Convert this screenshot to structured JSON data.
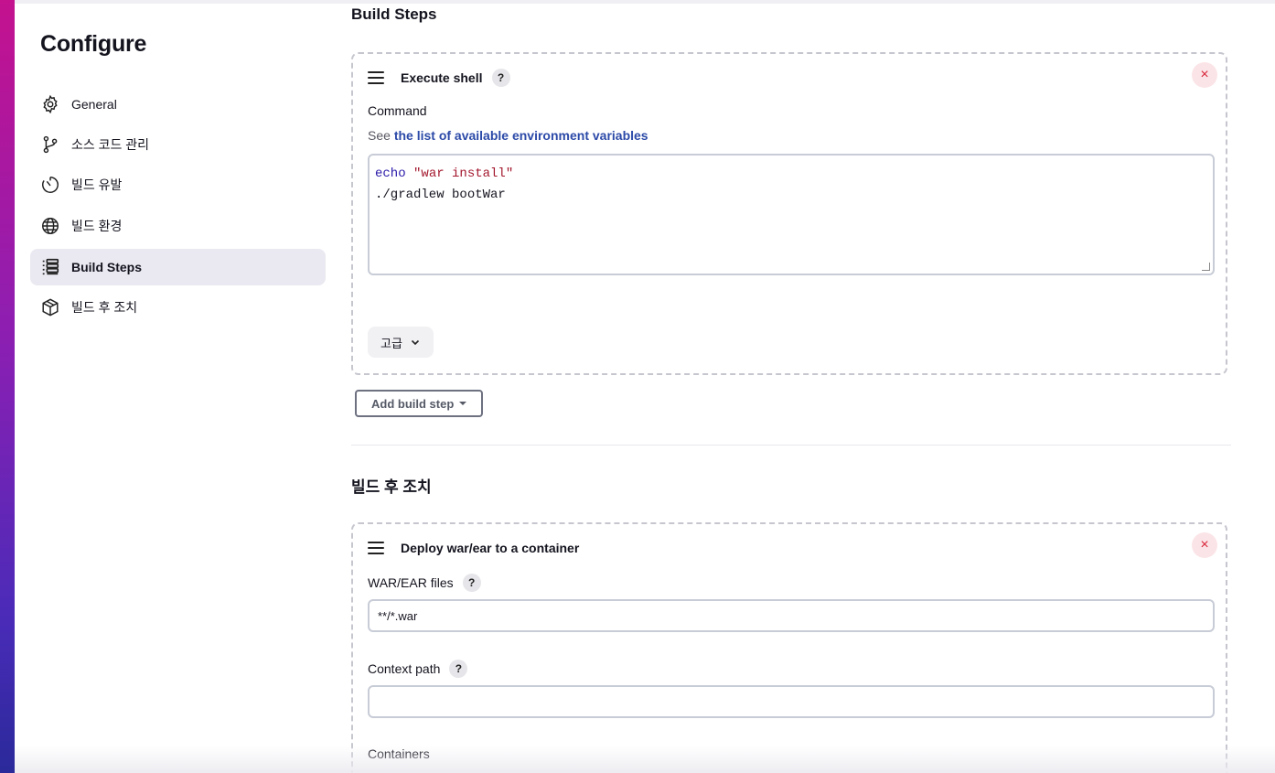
{
  "sidebar": {
    "title": "Configure",
    "items": [
      {
        "label": "General",
        "icon": "gear-icon"
      },
      {
        "label": "소스 코드 관리",
        "icon": "branch-icon"
      },
      {
        "label": "빌드 유발",
        "icon": "timer-icon"
      },
      {
        "label": "빌드 환경",
        "icon": "globe-icon"
      },
      {
        "label": "Build Steps",
        "icon": "list-steps-icon",
        "active": true
      },
      {
        "label": "빌드 후 조치",
        "icon": "package-icon"
      }
    ]
  },
  "build_steps": {
    "section_title": "Build Steps",
    "execute_shell": {
      "title": "Execute shell",
      "help": "?",
      "close": "×",
      "command_label": "Command",
      "see_prefix": "See",
      "env_link": "the list of available environment variables",
      "code": {
        "line1_keyword": "echo",
        "line1_string": "\"war install\"",
        "line2": "./gradlew bootWar"
      },
      "advanced_label": "고급"
    },
    "add_build_step_label": "Add build step"
  },
  "post_build": {
    "section_title": "빌드 후 조치",
    "deploy": {
      "title": "Deploy war/ear to a container",
      "close": "×",
      "war_label": "WAR/EAR files",
      "war_value": "**/*.war",
      "context_label": "Context path",
      "context_value": "",
      "containers_label": "Containers",
      "help": "?"
    }
  },
  "colors": {
    "accent_link": "#2c4aa8",
    "active_nav_bg": "#eae9f1",
    "close_red": "#d8263b"
  }
}
